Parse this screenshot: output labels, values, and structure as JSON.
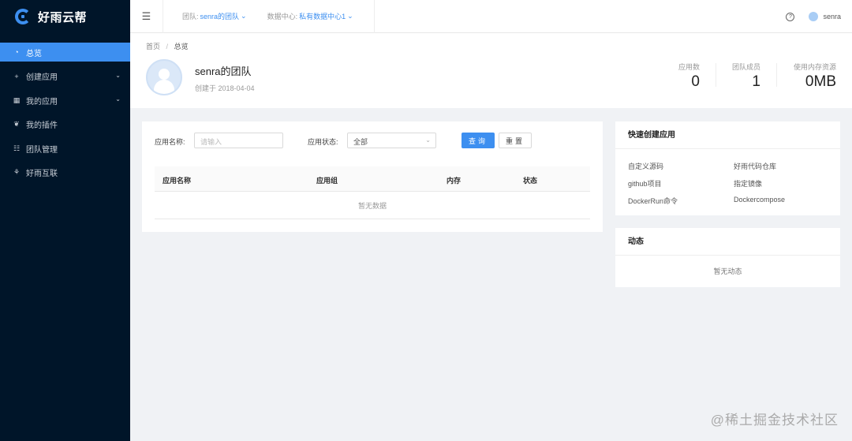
{
  "app": {
    "name": "好雨云帮"
  },
  "sidebar": {
    "items": [
      {
        "icon": "dashboard-icon",
        "label": "总览",
        "active": true
      },
      {
        "icon": "plus-icon",
        "label": "创建应用",
        "has_arrow": true
      },
      {
        "icon": "grid-icon",
        "label": "我的应用",
        "has_arrow": true
      },
      {
        "icon": "plugin-icon",
        "label": "我的插件"
      },
      {
        "icon": "team-icon",
        "label": "团队管理"
      },
      {
        "icon": "link-icon",
        "label": "好雨互联"
      }
    ]
  },
  "header": {
    "team_label": "团队:",
    "team_value": "senra的团队",
    "datacenter_label": "数据中心:",
    "datacenter_value": "私有数据中心1",
    "username": "senra"
  },
  "pagehead": {
    "breadcrumb": [
      "首页",
      "总览"
    ],
    "team_name": "senra的团队",
    "created": "创建于 2018-04-04",
    "stats": [
      {
        "label": "应用数",
        "value": "0"
      },
      {
        "label": "团队成员",
        "value": "1"
      },
      {
        "label": "使用内存资源",
        "value": "0MB"
      }
    ]
  },
  "filter": {
    "name_label": "应用名称:",
    "name_placeholder": "请输入",
    "status_label": "应用状态:",
    "status_value": "全部",
    "query_button": "查询",
    "reset_button": "重置"
  },
  "table": {
    "columns": [
      "应用名称",
      "应用组",
      "内存",
      "状态"
    ],
    "empty_text": "暂无数据"
  },
  "quick_create": {
    "title": "快速创建应用",
    "links": [
      "自定义源码",
      "好雨代码仓库",
      "github项目",
      "指定镜像",
      "DockerRun命令",
      "Dockercompose"
    ]
  },
  "activity": {
    "title": "动态",
    "empty_text": "暂无动态"
  },
  "watermark": "@稀土掘金技术社区",
  "colors": {
    "primary": "#3d8ff0",
    "sidebar_bg": "#001529"
  }
}
